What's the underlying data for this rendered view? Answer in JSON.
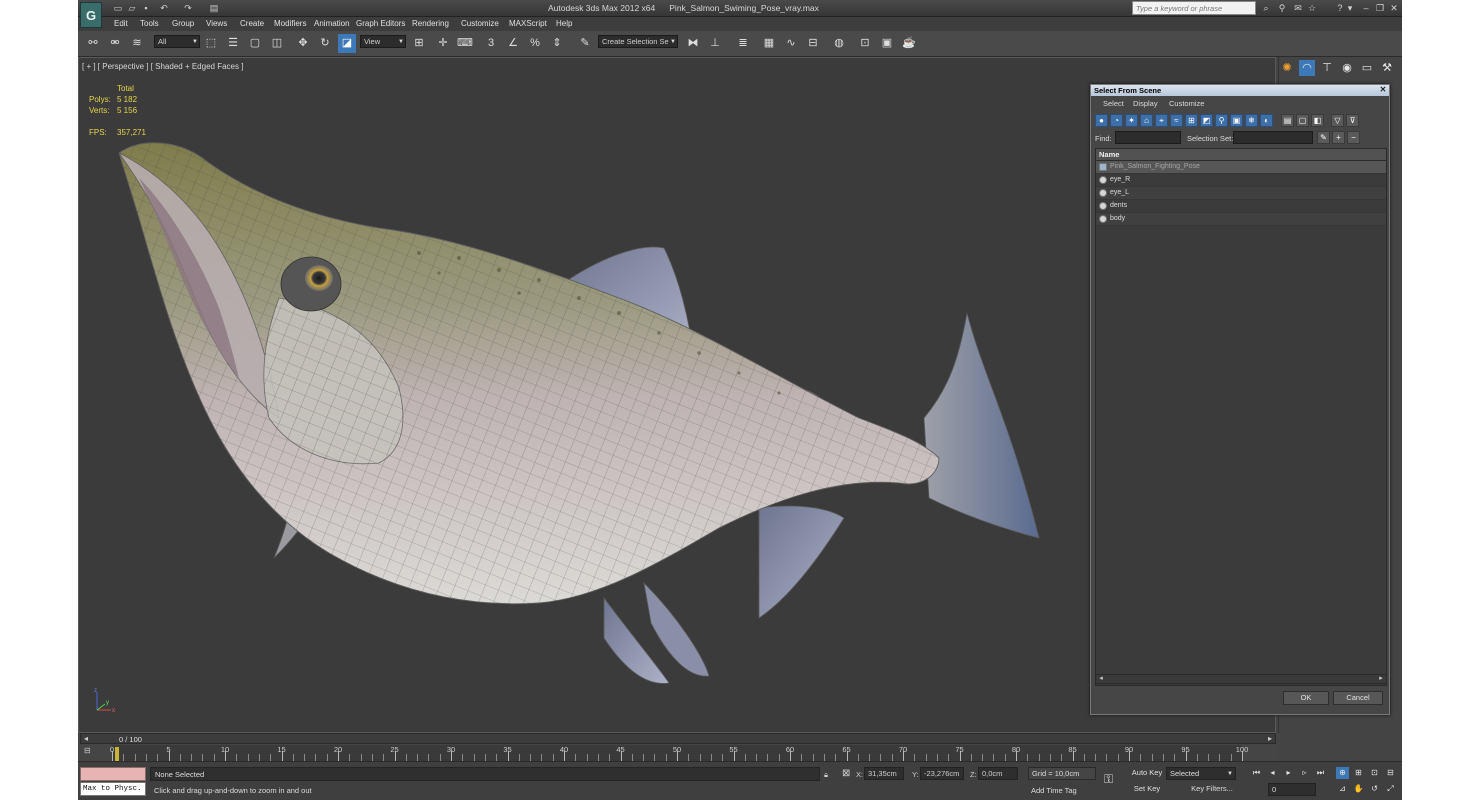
{
  "app": {
    "logo_text": "G",
    "title": "Autodesk 3ds Max  2012 x64",
    "file": "Pink_Salmon_Swiming_Pose_vray.max",
    "search_placeholder": "Type a keyword or phrase"
  },
  "menu": [
    "Edit",
    "Tools",
    "Group",
    "Views",
    "Create",
    "Modifiers",
    "Animation",
    "Graph Editors",
    "Rendering",
    "Customize",
    "MAXScript",
    "Help"
  ],
  "toolbar": {
    "filter_value": "All",
    "ref_coord_value": "View",
    "selection_set_value": "Create Selection Se",
    "snap_label": "3",
    "percent_label": "%"
  },
  "viewport": {
    "label": "[ + ] [ Perspective ] [ Shaded + Edged Faces ]",
    "stats": {
      "header": "Total",
      "polys_label": "Polys:",
      "polys_value": "5 182",
      "verts_label": "Verts:",
      "verts_value": "5 156",
      "fps_label": "FPS:",
      "fps_value": "357,271"
    },
    "axis": {
      "x": "x",
      "y": "y",
      "z": "z"
    }
  },
  "select_from_scene": {
    "title": "Select From Scene",
    "menu": [
      "Select",
      "Display",
      "Customize"
    ],
    "find_label": "Find:",
    "selection_set_label": "Selection Set:",
    "column_name": "Name",
    "items": [
      {
        "name": "Pink_Salmon_Fighting_Pose",
        "kind": "group"
      },
      {
        "name": "eye_R",
        "kind": "mesh"
      },
      {
        "name": "eye_L",
        "kind": "mesh"
      },
      {
        "name": "dents",
        "kind": "mesh"
      },
      {
        "name": "body",
        "kind": "mesh"
      }
    ],
    "ok_label": "OK",
    "cancel_label": "Cancel"
  },
  "timeline": {
    "slider_label": "0 / 100",
    "ticks": [
      0,
      5,
      10,
      15,
      20,
      25,
      30,
      35,
      40,
      45,
      50,
      55,
      60,
      65,
      70,
      75,
      80,
      85,
      90,
      95,
      100
    ],
    "frame_max": 100
  },
  "status": {
    "maxscript_text": "Max to Physc.",
    "selection_text": "None Selected",
    "prompt": "Click and drag up-and-down to zoom in and out",
    "x_label": "X:",
    "x_value": "31,35cm",
    "y_label": "Y:",
    "y_value": "-23,276cm",
    "z_label": "Z:",
    "z_value": "0,0cm",
    "grid": "Grid = 10,0cm",
    "add_time_tag": "Add Time Tag",
    "auto_key": "Auto Key",
    "set_key": "Set Key",
    "selected_mode": "Selected",
    "key_filters": "Key Filters...",
    "frame_value": "0"
  }
}
